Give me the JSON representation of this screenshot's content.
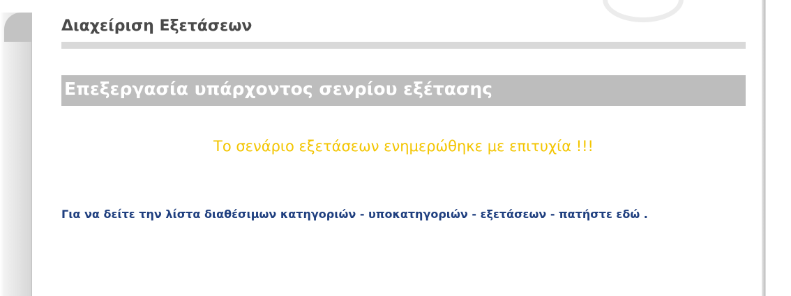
{
  "page_title": "Διαχείριση Εξετάσεων",
  "section_header": "Επεξεργασία υπάρχοντος σενρίου εξέτασης",
  "success_message": "Το σενάριο εξετάσεων ενημερώθηκε με επιτυχία !!!",
  "info": {
    "text_before_link": "Για να δείτε την λίστα διαθέσιμων κατηγοριών - υποκατηγοριών - εξετάσεων - πατήστε ",
    "link_text": "εδώ",
    "text_after_link": " ."
  },
  "colors": {
    "success": "#f3c500",
    "info_text": "#1f3f7f",
    "header_bg": "#bdbdbd"
  }
}
